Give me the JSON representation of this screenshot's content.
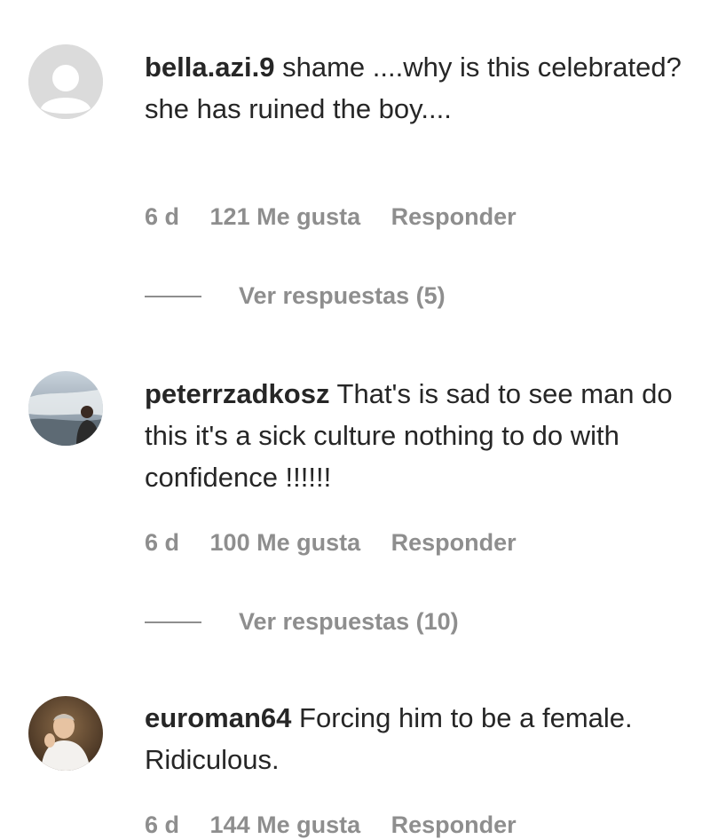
{
  "comments": [
    {
      "username": "bella.azi.9",
      "text": "shame ....why is this celebrated? she has ruined the boy....",
      "time": "6 d",
      "likes": "121 Me gusta",
      "reply_label": "Responder",
      "view_replies": "Ver respuestas (5)",
      "avatar_icon": "default-profile-icon"
    },
    {
      "username": "peterrzadkosz",
      "text": "That's is sad to see man do this it's a sick culture nothing to do with confidence !!!!!!",
      "time": "6 d",
      "likes": "100 Me gusta",
      "reply_label": "Responder",
      "view_replies": "Ver respuestas (10)",
      "avatar_icon": "profile-photo-icon"
    },
    {
      "username": "euroman64",
      "text": "Forcing him to be a female. Ridiculous.",
      "time": "6 d",
      "likes": "144 Me gusta",
      "reply_label": "Responder",
      "avatar_icon": "profile-photo-icon"
    }
  ],
  "colors": {
    "text": "#262626",
    "secondary": "#8e8e8e",
    "avatar_placeholder": "#dbdbdb"
  }
}
